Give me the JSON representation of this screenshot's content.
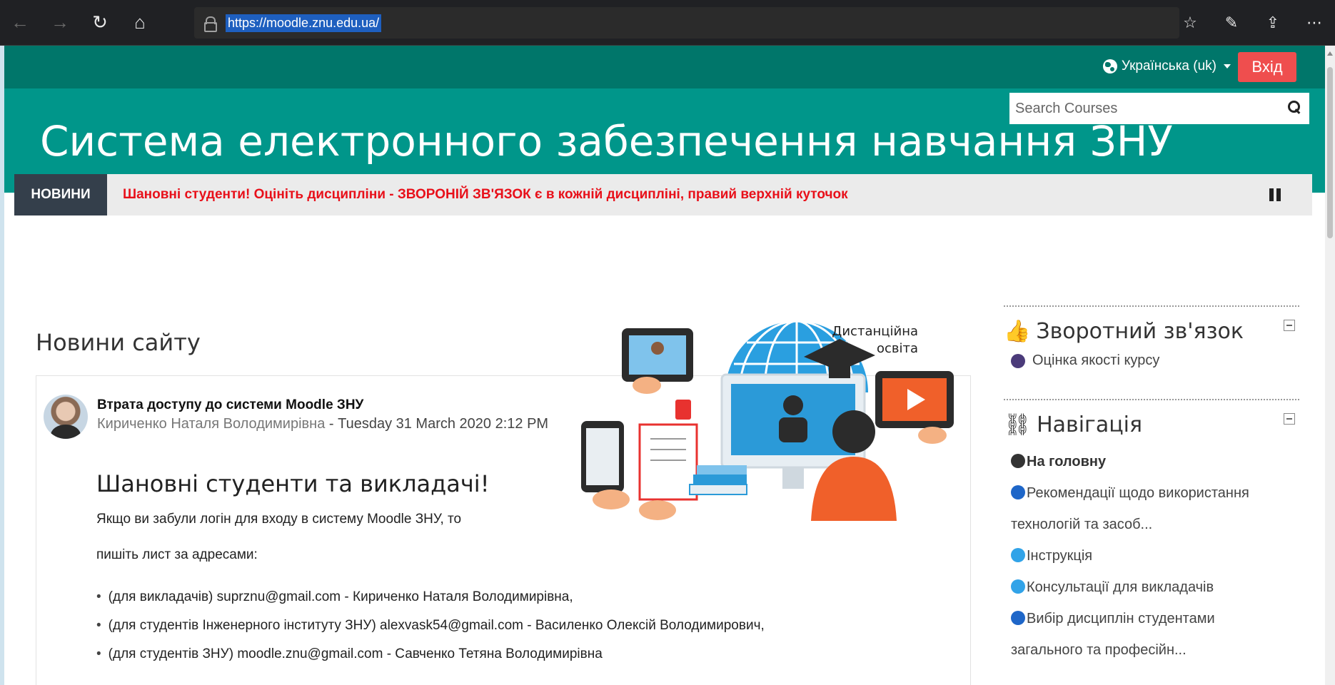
{
  "browser": {
    "url": "https://moodle.znu.edu.ua/"
  },
  "topbar": {
    "language": "Українська (uk)",
    "login_label": "Вхід"
  },
  "header": {
    "site_title": "Система електронного забезпечення навчання ЗНУ",
    "search_placeholder": "Search Courses"
  },
  "ticker": {
    "label": "НОВИНИ",
    "text": "Шановні студенти! Оцініть дисципліни - ЗВОРОНІЙ ЗВ'ЯЗОК є в кожній дисципліні, правий верхній куточок"
  },
  "news": {
    "section_title": "Новини сайту",
    "post_title": "Втрата доступу до системи Moodle ЗНУ",
    "author": "Кириченко Наталя Володимирівна",
    "date": " - Tuesday 31 March 2020 2:12 PM",
    "heading": "Шановні студенти та викладачі!",
    "p1": "Якщо  ви забули логін  для входу в систему Moodle ЗНУ, то",
    "p2": "пишіть лист за адресами:",
    "contacts": [
      "(для викладачів) suprznu@gmail.com - Кириченко Наталя Володимирівна,",
      "(для студентів Інженерного інституту ЗНУ) alexvask54@gmail.com  - Василенко Олексій Володимирович,",
      "(для студентів ЗНУ) moodle.znu@gmail.com - Савченко Тетяна Володимирівна"
    ],
    "hero_caption_1": "Дистанційна",
    "hero_caption_2": "освіта"
  },
  "sidebar": {
    "feedback_title": "Зворотний зв'язок",
    "feedback_link": "Оцінка якості курсу",
    "nav_title": "Навігація",
    "nav_items": [
      "На головну",
      "Рекомендації щодо використання",
      "технологій та засоб...",
      "Інструкція",
      "Консультації для викладачів",
      "Вибір дисциплін студентами",
      "загального та професійн..."
    ]
  }
}
